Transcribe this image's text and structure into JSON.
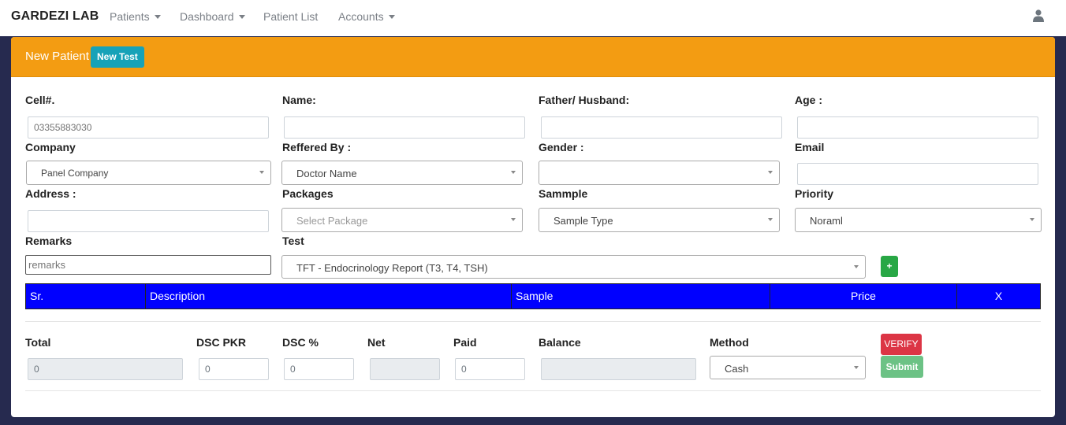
{
  "navbar": {
    "brand": "GARDEZI LAB",
    "items": [
      {
        "label": "Patients",
        "dropdown": true
      },
      {
        "label": "Dashboard",
        "dropdown": true
      },
      {
        "label": "Patient List",
        "dropdown": false
      },
      {
        "label": "Accounts",
        "dropdown": true
      }
    ],
    "user_icon": "user-icon"
  },
  "header": {
    "title": "New Patient",
    "new_test_label": "New Test",
    "color": "#f39c12"
  },
  "form": {
    "cell": {
      "label": "Cell#.",
      "placeholder": "03355883030"
    },
    "name": {
      "label": "Name:"
    },
    "father": {
      "label": "Father/ Husband:"
    },
    "age": {
      "label": "Age :"
    },
    "company": {
      "label": "Company",
      "value": "Panel Company"
    },
    "referred_by": {
      "label": "Reffered By :",
      "value": "Doctor Name"
    },
    "gender": {
      "label": "Gender :",
      "value": ""
    },
    "email": {
      "label": "Email"
    },
    "address": {
      "label": "Address :"
    },
    "packages": {
      "label": "Packages",
      "placeholder": "Select Package"
    },
    "sample": {
      "label": "Sammple",
      "value": "Sample Type"
    },
    "priority": {
      "label": "Priority",
      "value": "Noraml"
    },
    "remarks": {
      "label": "Remarks",
      "placeholder": "remarks"
    },
    "test": {
      "label": "Test",
      "value": "TFT - Endocrinology Report (T3, T4, TSH)"
    },
    "add_label": "+"
  },
  "table": {
    "columns": [
      "Sr.",
      "Description",
      "Sample",
      "Price",
      "X"
    ],
    "header_color": "#0000ff"
  },
  "totals": {
    "total": {
      "label": "Total",
      "value": "0"
    },
    "dsc_pkr": {
      "label": "DSC PKR",
      "value": "0"
    },
    "dsc_pct": {
      "label": "DSC %",
      "value": "0"
    },
    "net": {
      "label": "Net",
      "value": ""
    },
    "paid": {
      "label": "Paid",
      "value": "0"
    },
    "balance": {
      "label": "Balance",
      "value": ""
    },
    "method": {
      "label": "Method",
      "value": "Cash"
    },
    "verify_label": "VERIFY",
    "submit_label": "Submit"
  }
}
